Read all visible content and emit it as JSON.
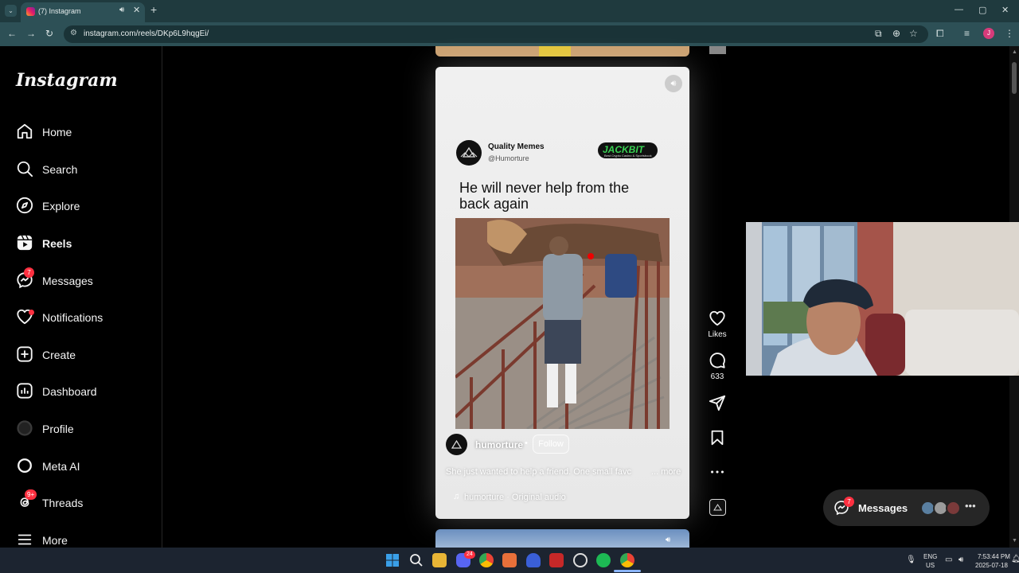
{
  "browser": {
    "tab_title": "(7) Instagram",
    "url": "instagram.com/reels/DKp6L9hqgEi/",
    "avatar_letter": "J"
  },
  "sidebar": {
    "logo": "Instagram",
    "items": [
      {
        "label": "Home",
        "icon": "home-icon"
      },
      {
        "label": "Search",
        "icon": "search-icon"
      },
      {
        "label": "Explore",
        "icon": "compass-icon"
      },
      {
        "label": "Reels",
        "icon": "reels-icon",
        "active": true
      },
      {
        "label": "Messages",
        "icon": "messenger-icon",
        "badge": "7"
      },
      {
        "label": "Notifications",
        "icon": "heart-icon",
        "dot": true
      },
      {
        "label": "Create",
        "icon": "plus-square-icon"
      },
      {
        "label": "Dashboard",
        "icon": "chart-icon"
      },
      {
        "label": "Profile",
        "icon": "profile-avatar"
      },
      {
        "label": "Meta AI",
        "icon": "meta-ai-icon"
      },
      {
        "label": "Threads",
        "icon": "threads-icon",
        "badge": "9+"
      },
      {
        "label": "More",
        "icon": "hamburger-icon"
      }
    ]
  },
  "reel": {
    "post_author_name": "Quality Memes",
    "post_author_handle": "@Humorture",
    "sponsor": "JACKBIT",
    "sponsor_tagline": "Best Crypto Casino & Sportsbook",
    "caption": "He will never help from the back again",
    "username": "humorture",
    "separator": "•",
    "follow_label": "Follow",
    "description": "She just wanted to help a friend. One small favc",
    "more_label": "... more",
    "audio": "humorture · Original audio"
  },
  "actions": {
    "likes_label": "Likes",
    "comments_count": "633"
  },
  "messages_pill": {
    "label": "Messages",
    "badge": "7"
  },
  "taskbar": {
    "lang_top": "ENG",
    "lang_bottom": "US",
    "time": "7:53:44 PM",
    "date": "2025-07-18",
    "discord_badge": "24"
  },
  "colors": {
    "accent_red": "#ff3040",
    "chrome_bg": "#2d5056",
    "tabbar_bg": "#1f3a3e",
    "page_bg": "#000000"
  }
}
